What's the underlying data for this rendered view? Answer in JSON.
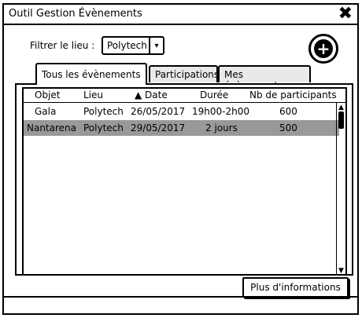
{
  "window": {
    "title": "Outil Gestion Évènements",
    "close_icon": "close-icon"
  },
  "filter": {
    "label": "Filtrer le lieu :",
    "selected": "Polytech",
    "arrow": "▾"
  },
  "add_button": {
    "icon": "plus-icon",
    "glyph": "+"
  },
  "tabs": [
    {
      "label": "Tous les évènements",
      "active": true
    },
    {
      "label": "Participations",
      "active": false
    },
    {
      "label": "Mes évènements",
      "active": false
    }
  ],
  "table": {
    "headers": [
      "Objet",
      "Lieu",
      "▲ Date",
      "Durée",
      "Nb de participants"
    ],
    "rows": [
      {
        "objet": "Gala",
        "lieu": "Polytech",
        "date": "26/05/2017",
        "duree": "19h00-2h00",
        "nb": "600",
        "selected": false
      },
      {
        "objet": "Nantarena",
        "lieu": "Polytech",
        "date": "29/05/2017",
        "duree": "2 jours",
        "nb": "500",
        "selected": true
      }
    ],
    "scroll_up": "▲",
    "scroll_down": "▼"
  },
  "buttons": {
    "more_info": "Plus d'informations"
  }
}
